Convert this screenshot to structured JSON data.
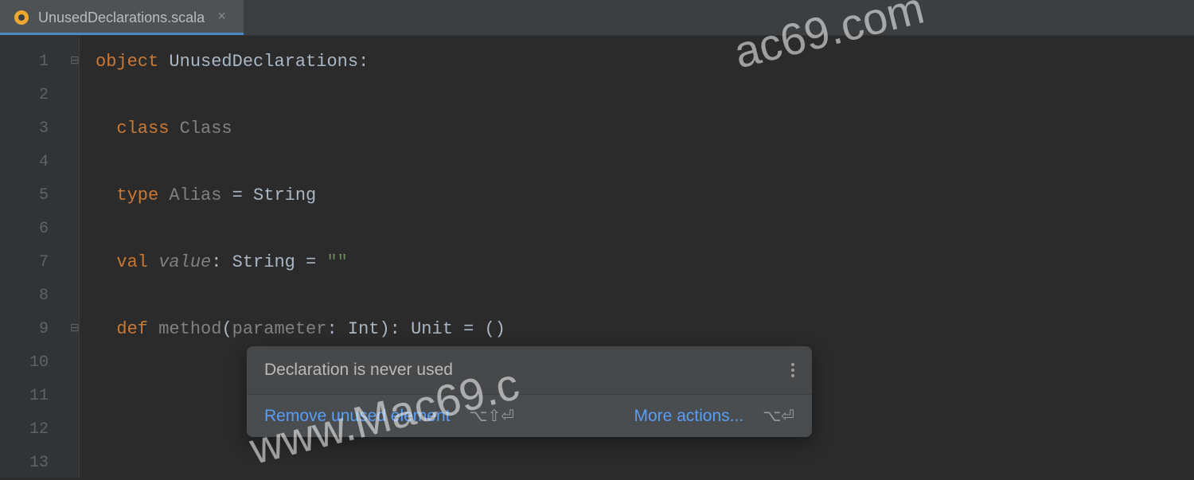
{
  "tab": {
    "filename": "UnusedDeclarations.scala",
    "close_glyph": "×"
  },
  "gutter": {
    "lines": [
      "1",
      "2",
      "3",
      "4",
      "5",
      "6",
      "7",
      "8",
      "9",
      "10",
      "11",
      "12",
      "13"
    ]
  },
  "code": {
    "line1": {
      "kw": "object",
      "name": "UnusedDeclarations",
      "colon": ":"
    },
    "line3": {
      "kw": "class",
      "name": "Class"
    },
    "line5": {
      "kw": "type",
      "name": "Alias",
      "eq": " = ",
      "rhs": "String"
    },
    "line7": {
      "kw": "val",
      "name": "value",
      "colon": ": ",
      "type": "String",
      "eq": " = ",
      "str": "\"\""
    },
    "line9": {
      "kw": "def",
      "name": "method",
      "lp": "(",
      "param": "parameter",
      "pcolon": ": ",
      "ptype": "Int",
      "rp": "): ",
      "rtype": "Unit",
      "eq": " = ()"
    }
  },
  "popup": {
    "title": "Declaration is never used",
    "action1": "Remove unused element",
    "shortcut1": "⌥⇧⏎",
    "action2": "More actions...",
    "shortcut2": "⌥⏎"
  },
  "watermark": {
    "text1": "ac69.com",
    "text2": "www.Mac69.c"
  }
}
